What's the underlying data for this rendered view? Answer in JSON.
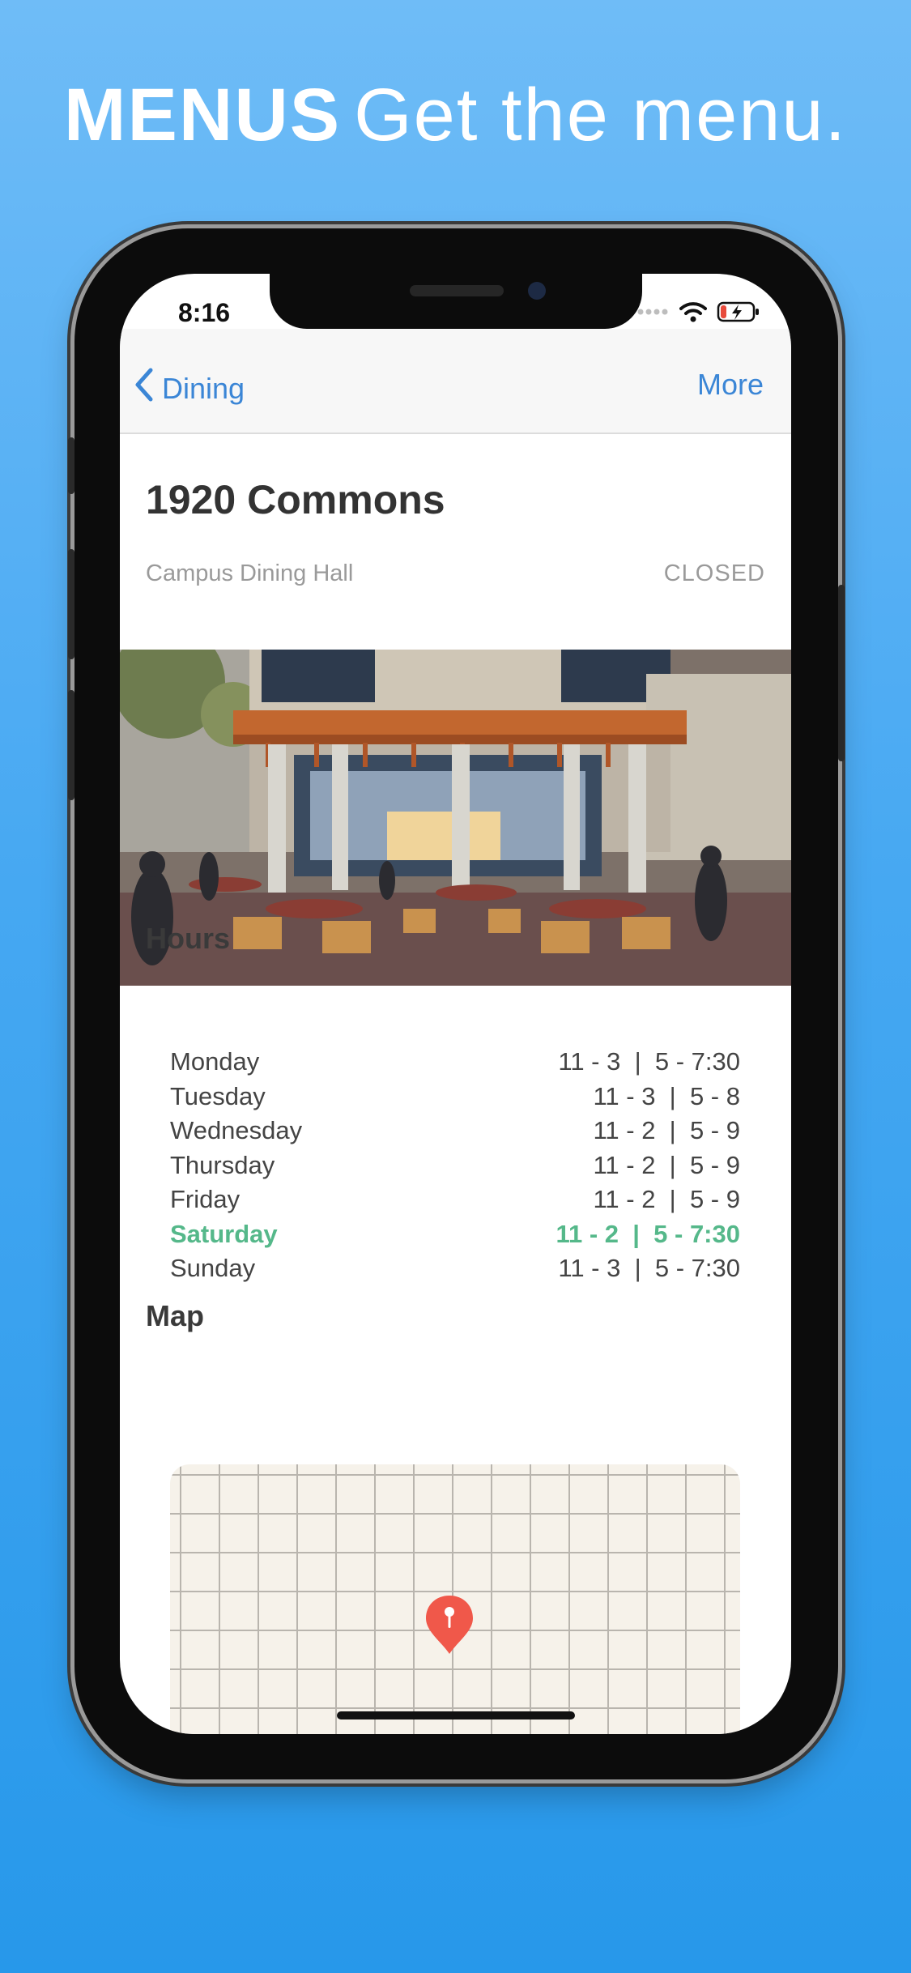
{
  "headline": {
    "bold": "MENUS",
    "light": "Get the menu."
  },
  "status_bar": {
    "time": "8:16",
    "icons": [
      "signal-dots-icon",
      "wifi-icon",
      "battery-charging-icon"
    ]
  },
  "nav": {
    "back_label": "Dining",
    "more_label": "More"
  },
  "location": {
    "name": "1920 Commons",
    "type": "Campus Dining Hall",
    "status": "CLOSED"
  },
  "hours": {
    "heading": "Hours",
    "rows": [
      {
        "day": "Monday",
        "time": "11 - 3  |  5 - 7:30"
      },
      {
        "day": "Tuesday",
        "time": "11 - 3  |  5 - 8"
      },
      {
        "day": "Wednesday",
        "time": "11 - 2  |  5 - 9"
      },
      {
        "day": "Thursday",
        "time": "11 - 2  |  5 - 9"
      },
      {
        "day": "Friday",
        "time": "11 - 2  |  5 - 9"
      },
      {
        "day": "Saturday",
        "time": "11 - 2  |  5 - 7:30"
      },
      {
        "day": "Sunday",
        "time": "11 - 3  |  5 - 7:30"
      }
    ],
    "highlight_day": "Saturday",
    "highlight_color": "#55b88a"
  },
  "map": {
    "heading": "Map",
    "pin_icon": "map-pin-icon",
    "pin_color": "#f0584a"
  },
  "colors": {
    "accent": "#3b86d6",
    "background_top": "#6fbcf7",
    "background_bottom": "#2798ea"
  }
}
